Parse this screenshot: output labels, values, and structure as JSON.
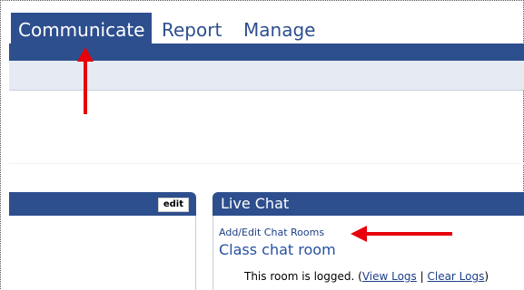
{
  "tabs": {
    "communicate": "Communicate",
    "report": "Report",
    "manage": "Manage"
  },
  "left_panel": {
    "edit_label": "edit"
  },
  "live_chat": {
    "title": "Live Chat",
    "add_edit_link": "Add/Edit Chat Rooms",
    "room_name": "Class chat room",
    "logged_prefix": "This room is logged. (",
    "view_logs": "View Logs",
    "separator": " | ",
    "clear_logs": "Clear Logs",
    "logged_suffix": ")"
  },
  "colors": {
    "primary_blue": "#2e4f8e",
    "arrow_red": "#e8000b",
    "link_blue": "#1d3f86"
  }
}
